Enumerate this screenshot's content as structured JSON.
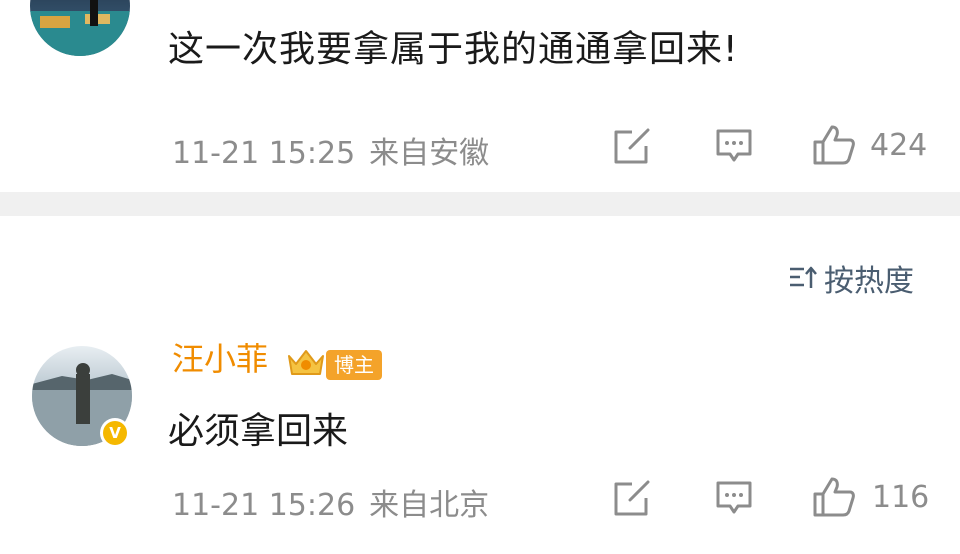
{
  "comment1": {
    "text": "这一次我要拿属于我的通通拿回来!",
    "time": "11-21 15:25",
    "location": "来自安徽",
    "likes": "424"
  },
  "sort": {
    "label": "按热度",
    "icon": "sort-icon"
  },
  "comment2": {
    "username": "汪小菲",
    "tag": "博主",
    "verified_badge": "V",
    "text": "必须拿回来",
    "time": "11-21 15:26",
    "location": "来自北京",
    "likes": "116"
  },
  "colors": {
    "username": "#f08c00",
    "meta": "#8c8c8c",
    "tag_bg": "#f4a32a",
    "separator": "#f0f0f0"
  }
}
